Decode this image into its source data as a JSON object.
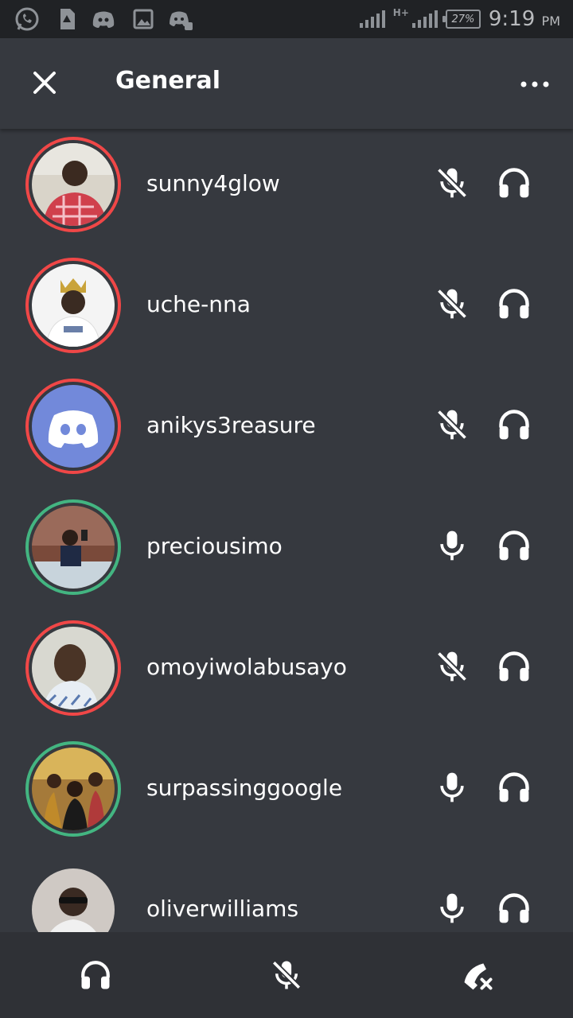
{
  "status_bar": {
    "battery": "27%",
    "time": "9:19",
    "ampm": "PM",
    "network": "H+",
    "icons": [
      "whatsapp-icon",
      "sim-icon",
      "discord-icon",
      "gallery-icon",
      "discord-notify-icon"
    ]
  },
  "header": {
    "title": "General",
    "close_icon": "close-icon",
    "more_icon": "more-icon"
  },
  "users": [
    {
      "name": "sunny4glow",
      "ring": "red",
      "mic": "muted",
      "avatar_style": "photo-red-shirt"
    },
    {
      "name": "uche-nna",
      "ring": "red",
      "mic": "muted",
      "avatar_style": "photo-crown"
    },
    {
      "name": "anikys3reasure",
      "ring": "red",
      "mic": "muted",
      "avatar_style": "discord-default"
    },
    {
      "name": "preciousimo",
      "ring": "green",
      "mic": "on",
      "avatar_style": "photo-room"
    },
    {
      "name": "omoyiwolabusayo",
      "ring": "red",
      "mic": "muted",
      "avatar_style": "photo-portrait"
    },
    {
      "name": "surpassinggoogle",
      "ring": "green",
      "mic": "on",
      "avatar_style": "photo-group"
    },
    {
      "name": "oliverwilliams",
      "ring": "none",
      "mic": "on",
      "avatar_style": "photo-sunglasses"
    }
  ],
  "bottom_bar": {
    "buttons": [
      "headphones-icon",
      "mic-muted-icon",
      "hangup-icon"
    ]
  },
  "colors": {
    "background": "#36393f",
    "speaking_ring": "#43b581",
    "muted_ring": "#f04747",
    "blurple": "#7289da"
  }
}
